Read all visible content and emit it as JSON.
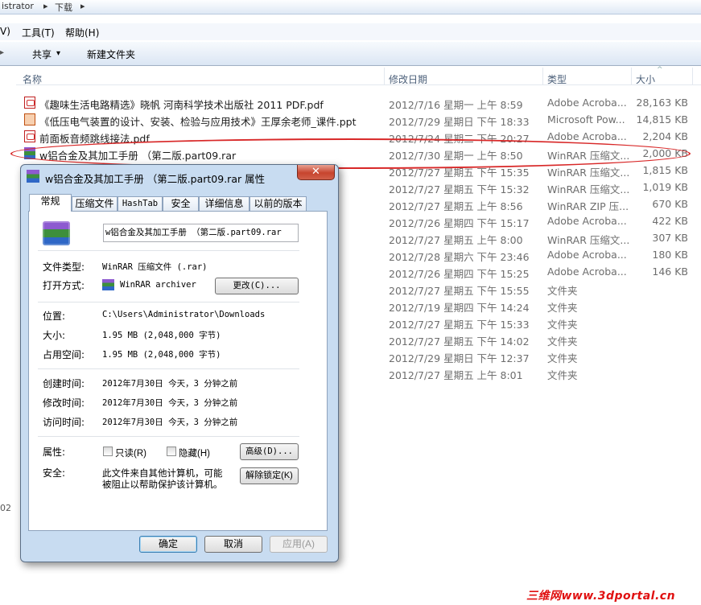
{
  "breadcrumb": {
    "part1": "istrator",
    "sep": "▸",
    "part2": "下载",
    "sep2": "▸"
  },
  "menu": {
    "view_fragment": "V)",
    "tools": "工具(T)",
    "help": "帮助(H)"
  },
  "toolbar": {
    "share": "共享",
    "share_arrow": "▾",
    "new_folder": "新建文件夹"
  },
  "columns": {
    "name": "名称",
    "modified": "修改日期",
    "type": "类型",
    "size": "大小"
  },
  "files": [
    {
      "name": "《趣味生活电路精选》晓帆 河南科学技术出版社 2011 PDF.pdf",
      "date": "2012/7/16 星期一 上午 8:59",
      "type": "Adobe Acroba...",
      "size": "28,163 KB",
      "icon": "pdf"
    },
    {
      "name": "《低压电气装置的设计、安装、检验与应用技术》王厚余老师_课件.ppt",
      "date": "2012/7/29 星期日 下午 18:33",
      "type": "Microsoft Pow...",
      "size": "14,815 KB",
      "icon": "ppt"
    },
    {
      "name": "前面板音频跳线接法.pdf",
      "date": "2012/7/24 星期二 下午 20:27",
      "type": "Adobe Acroba...",
      "size": "2,204 KB",
      "icon": "pdf"
    },
    {
      "name": "w铝合金及其加工手册 （第二版.part09.rar",
      "date": "2012/7/30 星期一 上午 8:50",
      "type": "WinRAR 压缩文...",
      "size": "2,000 KB",
      "icon": "rar"
    },
    {
      "name": "",
      "date": "2012/7/27 星期五 下午 15:35",
      "type": "WinRAR 压缩文...",
      "size": "1,815 KB",
      "icon": ""
    },
    {
      "name": "",
      "date": "2012/7/27 星期五 下午 15:32",
      "type": "WinRAR 压缩文...",
      "size": "1,019 KB",
      "icon": ""
    },
    {
      "name": "",
      "date": "2012/7/27 星期五 上午 8:56",
      "type": "WinRAR ZIP 压...",
      "size": "670 KB",
      "icon": ""
    },
    {
      "name": "",
      "date": "2012/7/26 星期四 下午 15:17",
      "type": "Adobe Acroba...",
      "size": "422 KB",
      "icon": ""
    },
    {
      "name": "",
      "date": "2012/7/27 星期五 上午 8:00",
      "type": "WinRAR 压缩文...",
      "size": "307 KB",
      "icon": ""
    },
    {
      "name": "",
      "date": "2012/7/28 星期六 下午 23:46",
      "type": "Adobe Acroba...",
      "size": "180 KB",
      "icon": ""
    },
    {
      "name": "",
      "date": "2012/7/26 星期四 下午 15:25",
      "type": "Adobe Acroba...",
      "size": "146 KB",
      "icon": ""
    },
    {
      "name": "",
      "date": "2012/7/27 星期五 下午 15:55",
      "type": "文件夹",
      "size": "",
      "icon": ""
    },
    {
      "name": "",
      "date": "2012/7/19 星期四 下午 14:24",
      "type": "文件夹",
      "size": "",
      "icon": ""
    },
    {
      "name": "",
      "date": "2012/7/27 星期五 下午 15:33",
      "type": "文件夹",
      "size": "",
      "icon": ""
    },
    {
      "name": "",
      "date": "2012/7/27 星期五 下午 14:02",
      "type": "文件夹",
      "size": "",
      "icon": ""
    },
    {
      "name": "",
      "date": "2012/7/29 星期日 下午 12:37",
      "type": "文件夹",
      "size": "",
      "icon": ""
    },
    {
      "name": "",
      "date": "2012/7/27 星期五 上午 8:01",
      "type": "文件夹",
      "size": "",
      "icon": ""
    }
  ],
  "dialog": {
    "title": "w铝合金及其加工手册 （第二版.part09.rar 属性",
    "close": "✕",
    "tabs": [
      "常规",
      "压缩文件",
      "HashTab",
      "安全",
      "详细信息",
      "以前的版本"
    ],
    "filename": "w铝合金及其加工手册 （第二版.part09.rar",
    "file_type_label": "文件类型:",
    "file_type_value": "WinRAR 压缩文件 (.rar)",
    "open_with_label": "打开方式:",
    "open_with_value": "WinRAR archiver",
    "change_button": "更改(C)...",
    "location_label": "位置:",
    "location_value": "C:\\Users\\Administrator\\Downloads",
    "size_label": "大小:",
    "size_value": "1.95 MB (2,048,000 字节)",
    "size_on_disk_label": "占用空间:",
    "size_on_disk_value": "1.95 MB (2,048,000 字节)",
    "created_label": "创建时间:",
    "created_value": "2012年7月30日 今天，3 分钟之前",
    "modified_label": "修改时间:",
    "modified_value": "2012年7月30日 今天，3 分钟之前",
    "accessed_label": "访问时间:",
    "accessed_value": "2012年7月30日 今天，3 分钟之前",
    "attributes_label": "属性:",
    "readonly_label": "只读(R)",
    "hidden_label": "隐藏(H)",
    "advanced_button": "高级(D)...",
    "security_label": "安全:",
    "security_text_line1": "此文件来自其他计算机，可能",
    "security_text_line2": "被阻止以帮助保护该计算机。",
    "unblock_button": "解除锁定(K)",
    "ok_button": "确定",
    "cancel_button": "取消",
    "apply_button": "应用(A)"
  },
  "left_edge_fragment": "02",
  "watermark": "三维网www.3dportal.cn",
  "colors": {
    "accent_red": "#d82828",
    "dialog_frame": "#c8dcf1"
  }
}
